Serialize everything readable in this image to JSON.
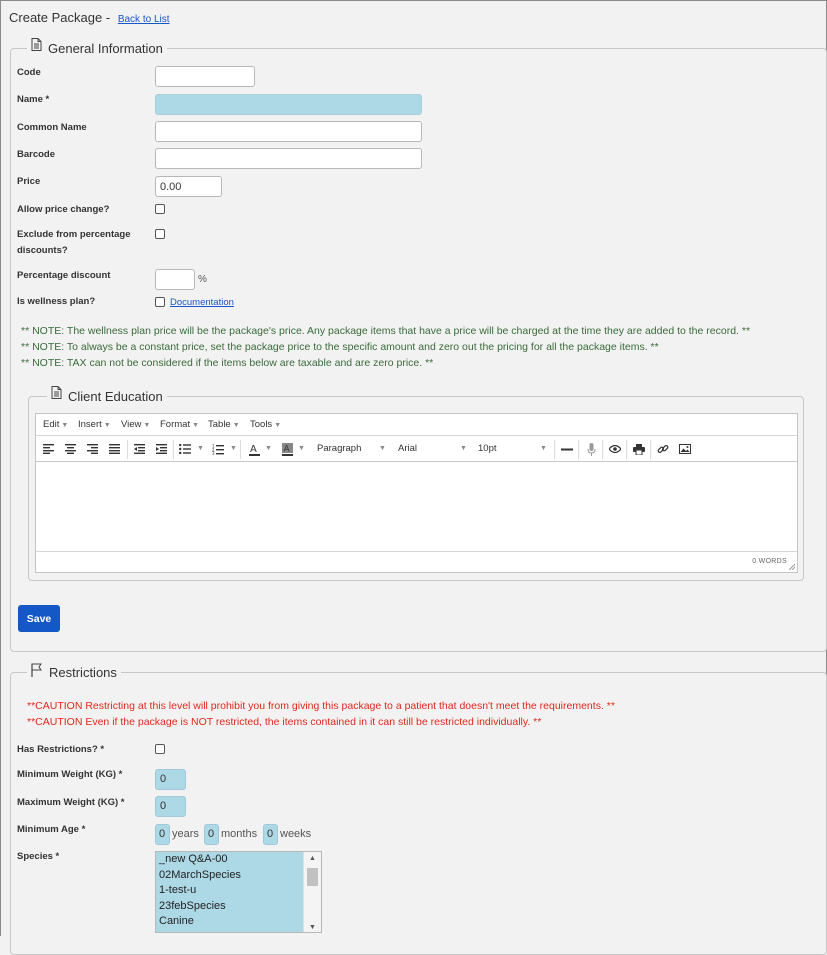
{
  "page": {
    "title": "Create Package",
    "separator": "-",
    "back_link": "Back to List"
  },
  "general": {
    "legend": "General Information",
    "code_label": "Code",
    "name_label": "Name *",
    "common_name_label": "Common Name",
    "barcode_label": "Barcode",
    "price_label": "Price",
    "price_value": "0.00",
    "allow_price_change_label": "Allow price change?",
    "exclude_label_line1": "Exclude from percentage",
    "exclude_label_line2": "discounts?",
    "percentage_discount_label": "Percentage discount",
    "percent_sign": "%",
    "wellness_label": "Is wellness plan?",
    "documentation_link": "Documentation",
    "notes": [
      "** NOTE: The wellness plan price will be the package's price. Any package items that have a price will be charged at the time they are added to the record. **",
      "** NOTE: To always be a constant price, set the package price to the specific amount and zero out the pricing for all the package items. **",
      "** NOTE: TAX can not be considered if the items below are taxable and are zero price. **"
    ]
  },
  "client_education": {
    "legend": "Client Education",
    "menus": [
      "Edit",
      "Insert",
      "View",
      "Format",
      "Table",
      "Tools"
    ],
    "block_format": "Paragraph",
    "font_family": "Arial",
    "font_size": "10pt",
    "word_count": "0 WORDS"
  },
  "save_label": "Save",
  "restrictions": {
    "legend": "Restrictions",
    "cautions": [
      "**CAUTION Restricting at this level will prohibit you from giving this package to a patient that doesn't meet the requirements. **",
      "**CAUTION Even if the package is NOT restricted, the items contained in it can still be restricted individually. **"
    ],
    "has_restrictions_label": "Has Restrictions? *",
    "min_weight_label": "Minimum Weight (KG) *",
    "min_weight_value": "0",
    "max_weight_label": "Maximum Weight (KG) *",
    "max_weight_value": "0",
    "min_age_label": "Minimum Age *",
    "years_value": "0",
    "years_unit": "years",
    "months_value": "0",
    "months_unit": "months",
    "weeks_value": "0",
    "weeks_unit": "weeks",
    "species_label": "Species *",
    "species_options": [
      "_new Q&A-00",
      "02MarchSpecies",
      "1-test-u",
      "23febSpecies",
      "Canine"
    ]
  },
  "colors": {
    "required_field": "#add8e6",
    "primary_button": "#1458c8",
    "note_text": "#3a6b3a",
    "caution_text": "#e0281e",
    "link": "#1a56c9"
  }
}
